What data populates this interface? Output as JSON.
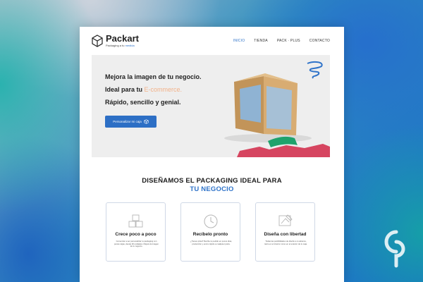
{
  "header": {
    "brand": "Packart",
    "tagline_prefix": "Packaging a tu",
    "tagline_accent": "medida"
  },
  "nav": [
    {
      "label": "INICIO",
      "active": true
    },
    {
      "label": "TIENDA",
      "active": false
    },
    {
      "label": "PACK · PLUS",
      "active": false
    },
    {
      "label": "CONTACTO",
      "active": false
    }
  ],
  "hero": {
    "line1": "Mejora la imagen de tu negocio.",
    "line2_prefix": "Ideal para tu",
    "line2_highlight": "E-commerce.",
    "line3": "Rápido, sencillo y genial.",
    "button_label": "Personalizar mi caja"
  },
  "section": {
    "title_line1": "DISEÑAMOS EL PACKAGING IDEAL PARA",
    "title_line2": "TU NEGOCIO"
  },
  "cards": [
    {
      "icon": "boxes-icon",
      "title": "Crece poco a poco",
      "text": "Comenzar a ser personalizar tu packaging con pocas cajas, desde 30 unidades. Mejora la imagen de tu negocio."
    },
    {
      "icon": "clock-icon",
      "title": "Recíbelo pronto",
      "text": "¿Tienes prisa? Recibe tu pedido en pocos días, producción y envío rápido a cualquier parte."
    },
    {
      "icon": "design-icon",
      "title": "Diseña con libertad",
      "text": "Todas las posibilidades de diseño a tu alcance, tanto en el interior como en el exterior de tu caja."
    }
  ],
  "colors": {
    "accent": "#2f73c9",
    "highlight": "#f2b28a",
    "hero_bg": "#eeeeee",
    "box_kraft": "#c9a06a",
    "box_label": "#8ab6e0",
    "shape_green": "#1fa26c",
    "shape_red": "#d64560"
  }
}
